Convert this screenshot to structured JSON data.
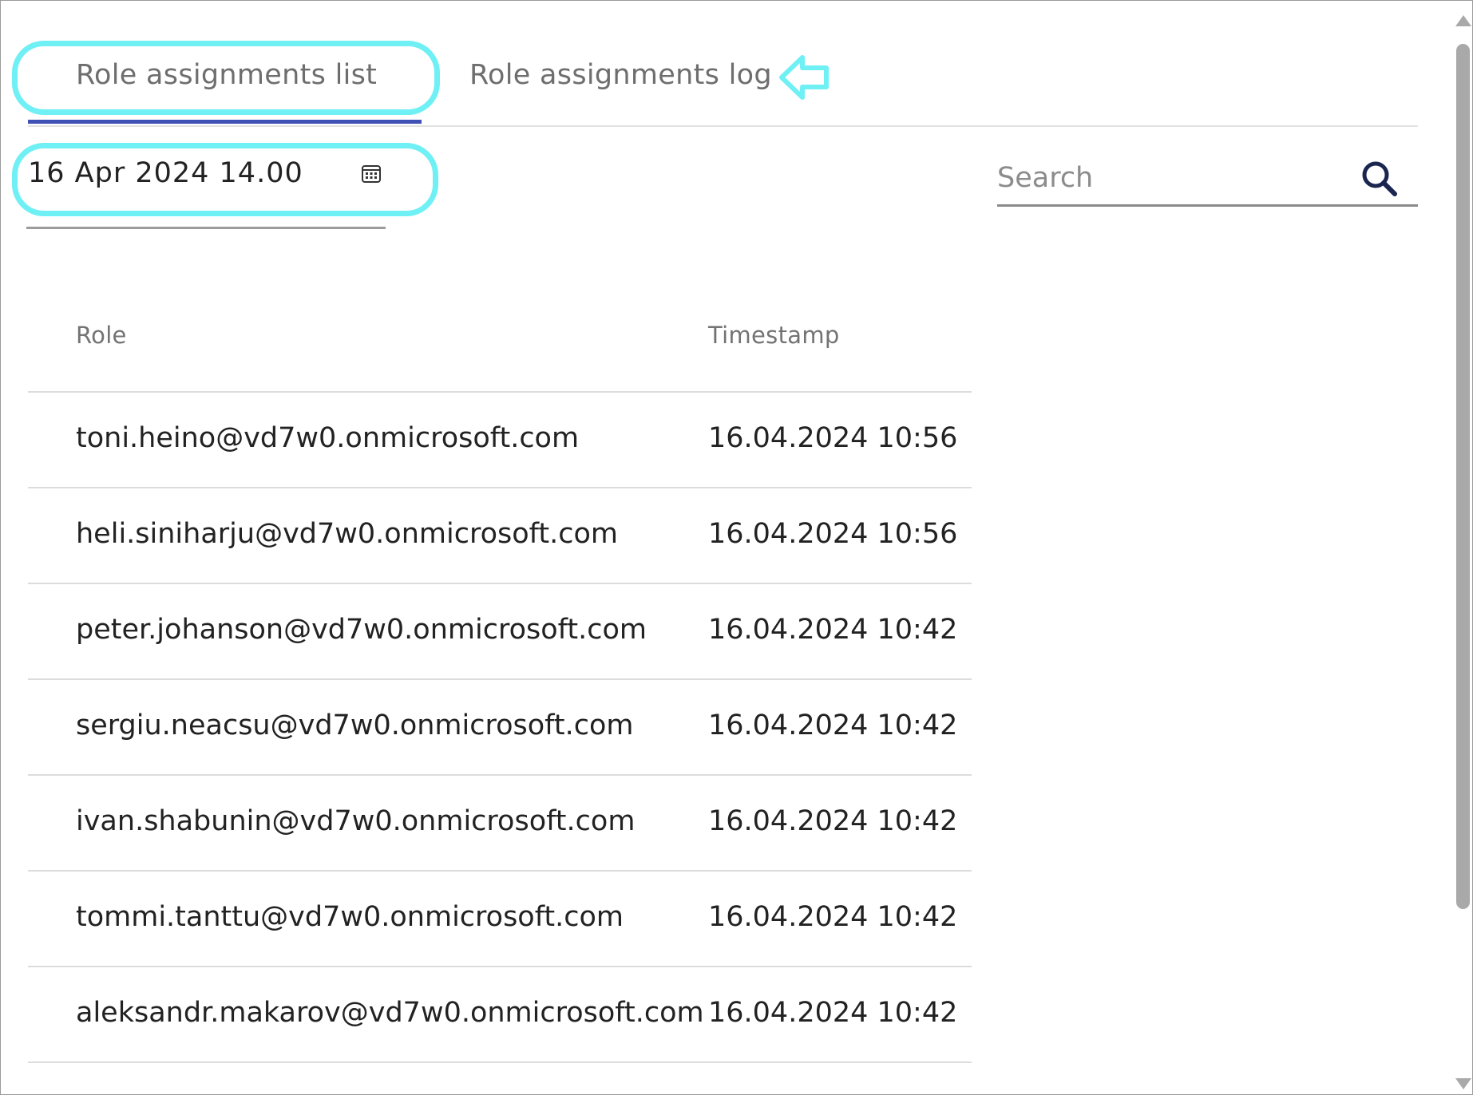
{
  "tabs": [
    {
      "label": "Role assignments list",
      "active": true
    },
    {
      "label": "Role assignments log",
      "active": false
    }
  ],
  "date_filter": {
    "value": "16  Apr  2024  14.00",
    "icon": "calendar-icon"
  },
  "search": {
    "placeholder": "Search",
    "value": "",
    "icon": "search-icon"
  },
  "table": {
    "columns": [
      "Role",
      "Timestamp"
    ],
    "rows": [
      {
        "role": "toni.heino@vd7w0.onmicrosoft.com",
        "timestamp": "16.04.2024 10:56"
      },
      {
        "role": "heli.siniharju@vd7w0.onmicrosoft.com",
        "timestamp": "16.04.2024 10:56"
      },
      {
        "role": "peter.johanson@vd7w0.onmicrosoft.com",
        "timestamp": "16.04.2024 10:42"
      },
      {
        "role": "sergiu.neacsu@vd7w0.onmicrosoft.com",
        "timestamp": "16.04.2024 10:42"
      },
      {
        "role": "ivan.shabunin@vd7w0.onmicrosoft.com",
        "timestamp": "16.04.2024 10:42"
      },
      {
        "role": "tommi.tanttu@vd7w0.onmicrosoft.com",
        "timestamp": "16.04.2024 10:42"
      },
      {
        "role": "aleksandr.makarov@vd7w0.onmicrosoft.com",
        "timestamp": "16.04.2024 10:42"
      }
    ]
  },
  "colors": {
    "accent": "#3f51b5",
    "highlight": "#6ff0f5",
    "icon_navy": "#1a2550"
  }
}
